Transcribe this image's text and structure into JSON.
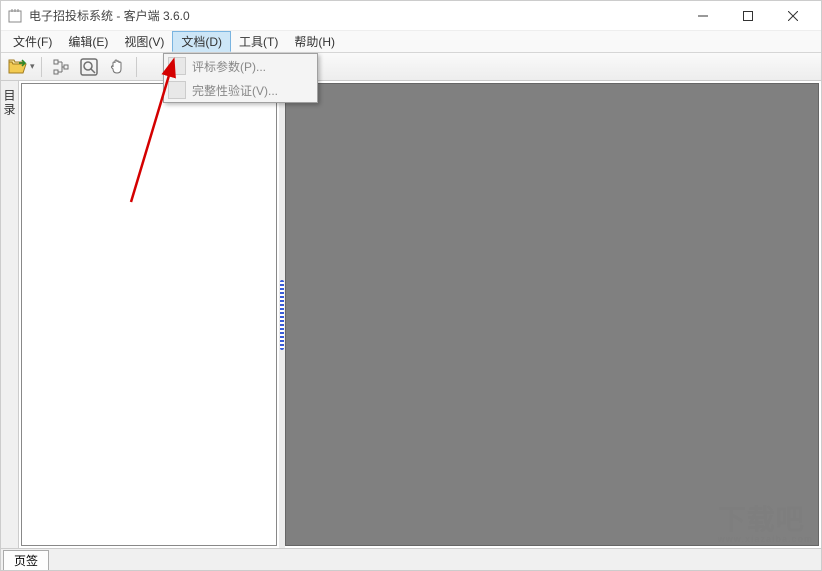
{
  "window": {
    "title": "电子招投标系统 - 客户端 3.6.0"
  },
  "menu": {
    "items": [
      {
        "label": "文件(F)"
      },
      {
        "label": "编辑(E)"
      },
      {
        "label": "视图(V)"
      },
      {
        "label": "文档(D)",
        "active": true
      },
      {
        "label": "工具(T)"
      },
      {
        "label": "帮助(H)"
      }
    ]
  },
  "dropdown": {
    "items": [
      {
        "label": "评标参数(P)..."
      },
      {
        "label": "完整性验证(V)..."
      }
    ]
  },
  "sidebar": {
    "catalog_label": "目录"
  },
  "statusbar": {
    "tab_label": "页签"
  },
  "watermark": {
    "main": "下载吧",
    "sub": "www.xiazaiba.com"
  }
}
